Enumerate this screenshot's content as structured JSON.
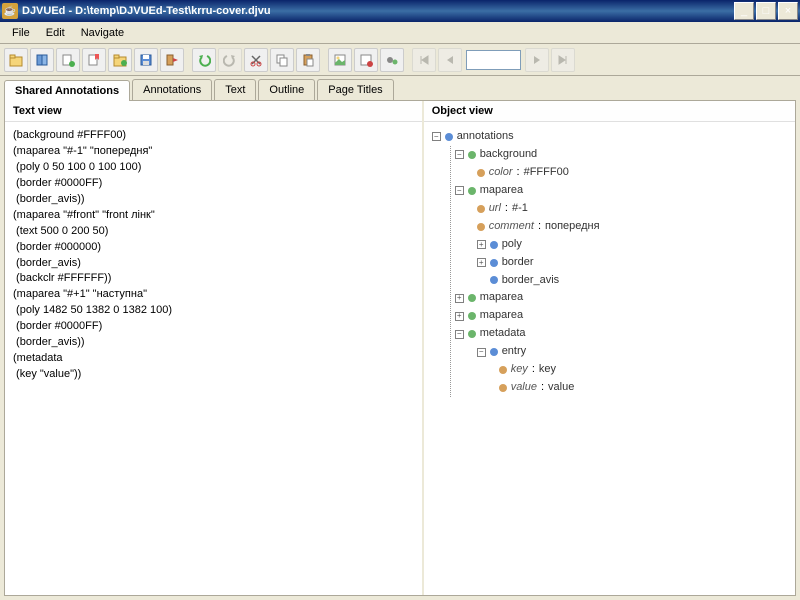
{
  "window": {
    "title": "DJVUEd - D:\\temp\\DJVUEd-Test\\krru-cover.djvu"
  },
  "menubar": {
    "items": [
      "File",
      "Edit",
      "Navigate"
    ]
  },
  "toolbar": {
    "icons": [
      "open",
      "book",
      "new-ann",
      "bookmark",
      "folder",
      "copy",
      "exit"
    ],
    "icons2": [
      "undo",
      "redo",
      "cut",
      "copy2",
      "paste"
    ],
    "icons3": [
      "img",
      "img-add",
      "gears"
    ],
    "icons4": [
      "first",
      "prev",
      "next",
      "last"
    ]
  },
  "tabs": [
    {
      "label": "Shared Annotations",
      "active": true
    },
    {
      "label": "Annotations",
      "active": false
    },
    {
      "label": "Text",
      "active": false
    },
    {
      "label": "Outline",
      "active": false
    },
    {
      "label": "Page Titles",
      "active": false
    }
  ],
  "panes": {
    "left": {
      "title": "Text view"
    },
    "right": {
      "title": "Object view"
    }
  },
  "textview": "(background #FFFF00)\n(maparea \"#-1\" \"попередня\"\n (poly 0 50 100 0 100 100)\n (border #0000FF)\n (border_avis))\n(maparea \"#front\" \"front лінк\"\n (text 500 0 200 50)\n (border #000000)\n (border_avis)\n (backclr #FFFFFF))\n(maparea \"#+1\" \"наступна\"\n (poly 1482 50 1382 0 1382 100)\n (border #0000FF)\n (border_avis))\n(metadata\n (key \"value\"))",
  "tree": {
    "root": {
      "label": "annotations"
    },
    "bg": {
      "label": "background",
      "color_key": "color",
      "color_val": "#FFFF00"
    },
    "maparea1": {
      "label": "maparea",
      "url_key": "url",
      "url_val": "#-1",
      "comment_key": "comment",
      "comment_val": "попередня",
      "poly": "poly",
      "border": "border",
      "border_avis": "border_avis"
    },
    "maparea2": {
      "label": "maparea"
    },
    "maparea3": {
      "label": "maparea"
    },
    "metadata": {
      "label": "metadata",
      "entry": "entry",
      "key_k": "key",
      "key_v": "key",
      "val_k": "value",
      "val_v": "value"
    }
  }
}
